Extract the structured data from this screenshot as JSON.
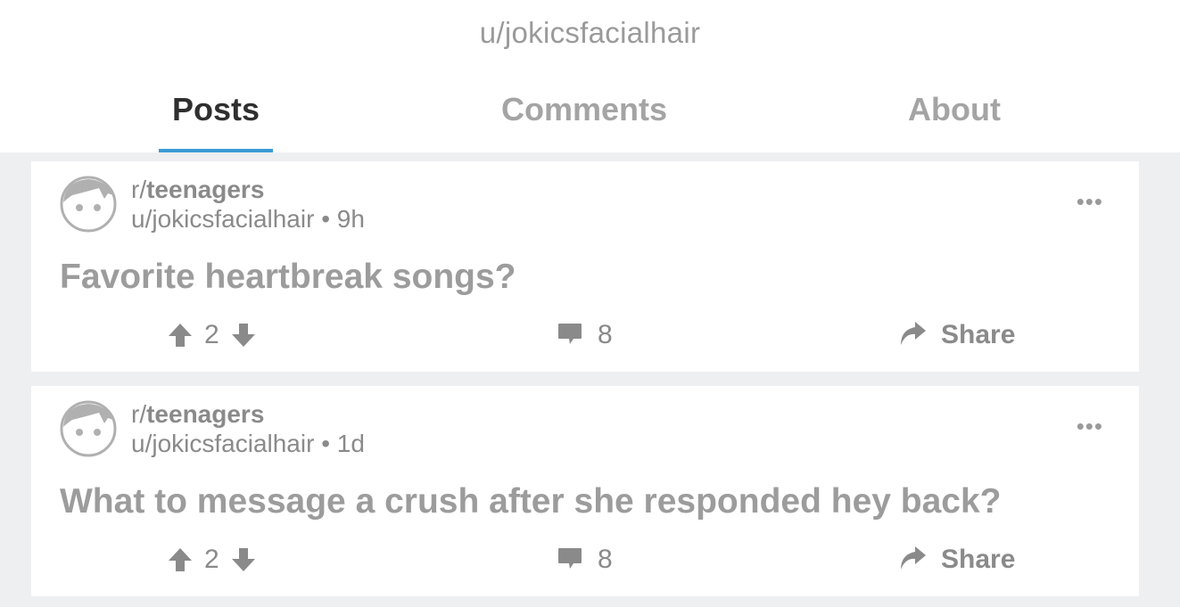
{
  "header": {
    "title": "u/jokicsfacialhair",
    "tabs": [
      {
        "label": "Posts",
        "active": true
      },
      {
        "label": "Comments",
        "active": false
      },
      {
        "label": "About",
        "active": false
      }
    ]
  },
  "colors": {
    "accent": "#3a9bd5",
    "background": "#eeeff1",
    "card": "#ffffff",
    "text_muted": "#8a8a8a"
  },
  "posts": [
    {
      "subreddit_prefix": "r/",
      "subreddit": "teenagers",
      "author": "u/jokicsfacialhair",
      "age": " • 9h",
      "more": "•••",
      "title": "Favorite heartbreak songs?",
      "score": "2",
      "comments": "8",
      "share_label": "Share"
    },
    {
      "subreddit_prefix": "r/",
      "subreddit": "teenagers",
      "author": "u/jokicsfacialhair",
      "age": " • 1d",
      "more": "•••",
      "title": "What to message a crush after she responded hey back?",
      "score": "2",
      "comments": "8",
      "share_label": "Share"
    }
  ],
  "icons": [
    "avatar-icon",
    "more-options-icon",
    "upvote-icon",
    "downvote-icon",
    "comment-icon",
    "share-icon"
  ]
}
